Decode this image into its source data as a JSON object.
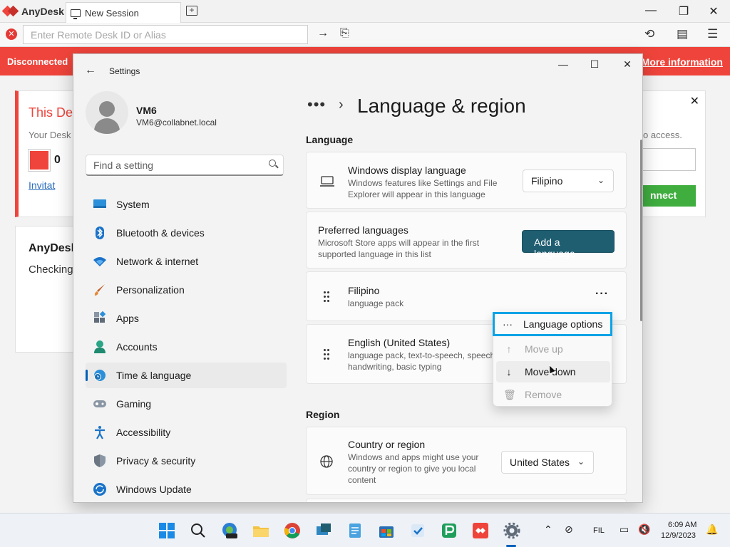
{
  "anydesk": {
    "app_name": "AnyDesk",
    "tab_label": "New Session",
    "address_placeholder": "Enter Remote Desk ID or Alias",
    "banner_left": "Disconnected",
    "banner_right": "More information",
    "card1": {
      "title": "This De",
      "subtitle": "Your Desk",
      "id_value": "0",
      "link": "Invitat"
    },
    "card2": {
      "title": "AnyDesk",
      "status": "Checking"
    },
    "card3": {
      "text": "o access.",
      "button": "nnect"
    },
    "colors": {
      "brand": "#ef443b",
      "connect": "#3fae3f"
    }
  },
  "settings": {
    "window_title": "Settings",
    "profile": {
      "name": "VM6",
      "email": "VM6@collabnet.local"
    },
    "search_placeholder": "Find a setting",
    "nav": [
      {
        "label": "System",
        "icon": "monitor-icon"
      },
      {
        "label": "Bluetooth & devices",
        "icon": "bluetooth-icon"
      },
      {
        "label": "Network & internet",
        "icon": "wifi-icon"
      },
      {
        "label": "Personalization",
        "icon": "brush-icon"
      },
      {
        "label": "Apps",
        "icon": "apps-icon"
      },
      {
        "label": "Accounts",
        "icon": "accounts-icon"
      },
      {
        "label": "Time & language",
        "icon": "globe-clock-icon",
        "active": true
      },
      {
        "label": "Gaming",
        "icon": "gamepad-icon"
      },
      {
        "label": "Accessibility",
        "icon": "accessibility-icon"
      },
      {
        "label": "Privacy & security",
        "icon": "shield-icon"
      },
      {
        "label": "Windows Update",
        "icon": "update-icon"
      }
    ],
    "breadcrumb_more": "•••",
    "page_title": "Language & region",
    "language_section": "Language",
    "display_language": {
      "title": "Windows display language",
      "desc": "Windows features like Settings and File Explorer will appear in this language",
      "value": "Filipino"
    },
    "preferred": {
      "title": "Preferred languages",
      "desc": "Microsoft Store apps will appear in the first supported language in this list",
      "button": "Add a language"
    },
    "languages": [
      {
        "name": "Filipino",
        "desc": "language pack"
      },
      {
        "name": "English (United States)",
        "desc": "language pack, text-to-speech, speech recognition, handwriting, basic typing"
      }
    ],
    "region_section": "Region",
    "country": {
      "title": "Country or region",
      "desc": "Windows and apps might use your country or region to give you local content",
      "value": "United States"
    },
    "context_menu": [
      {
        "label": "Language options",
        "icon": "more-icon",
        "state": "highlighted"
      },
      {
        "label": "Move up",
        "icon": "arrow-up-icon",
        "state": "disabled"
      },
      {
        "label": "Move down",
        "icon": "arrow-down-icon",
        "state": "hover"
      },
      {
        "label": "Remove",
        "icon": "trash-icon",
        "state": "disabled"
      }
    ],
    "colors": {
      "accent": "#005fb8",
      "button": "#1f5e71",
      "menu_highlight": "#0aa3e6"
    }
  },
  "taskbar": {
    "lang": "FIL",
    "time": "6:09 AM",
    "date": "12/9/2023"
  }
}
